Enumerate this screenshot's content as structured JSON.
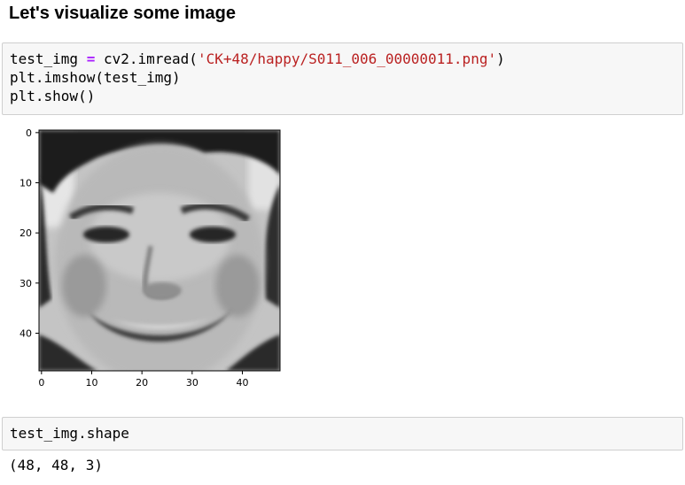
{
  "heading": "Let's visualize some image",
  "cell1": {
    "line1": {
      "var": "test_img ",
      "op": "=",
      "call": " cv2.imread(",
      "arg": "'CK+48/happy/S011_006_00000011.png'",
      "close": ")"
    },
    "line2": "plt.imshow(test_img)",
    "line3": "plt.show()"
  },
  "cell2": {
    "code": "test_img.shape"
  },
  "output": "(48, 48, 3)",
  "chart_data": {
    "type": "heatmap",
    "title": "",
    "xlabel": "",
    "ylabel": "",
    "xlim": [
      0,
      48
    ],
    "ylim": [
      48,
      0
    ],
    "x_ticks": [
      0,
      10,
      20,
      30,
      40
    ],
    "y_ticks": [
      0,
      10,
      20,
      30,
      40
    ],
    "image_size": [
      48,
      48
    ],
    "colormap": "grayscale",
    "grid": false
  }
}
